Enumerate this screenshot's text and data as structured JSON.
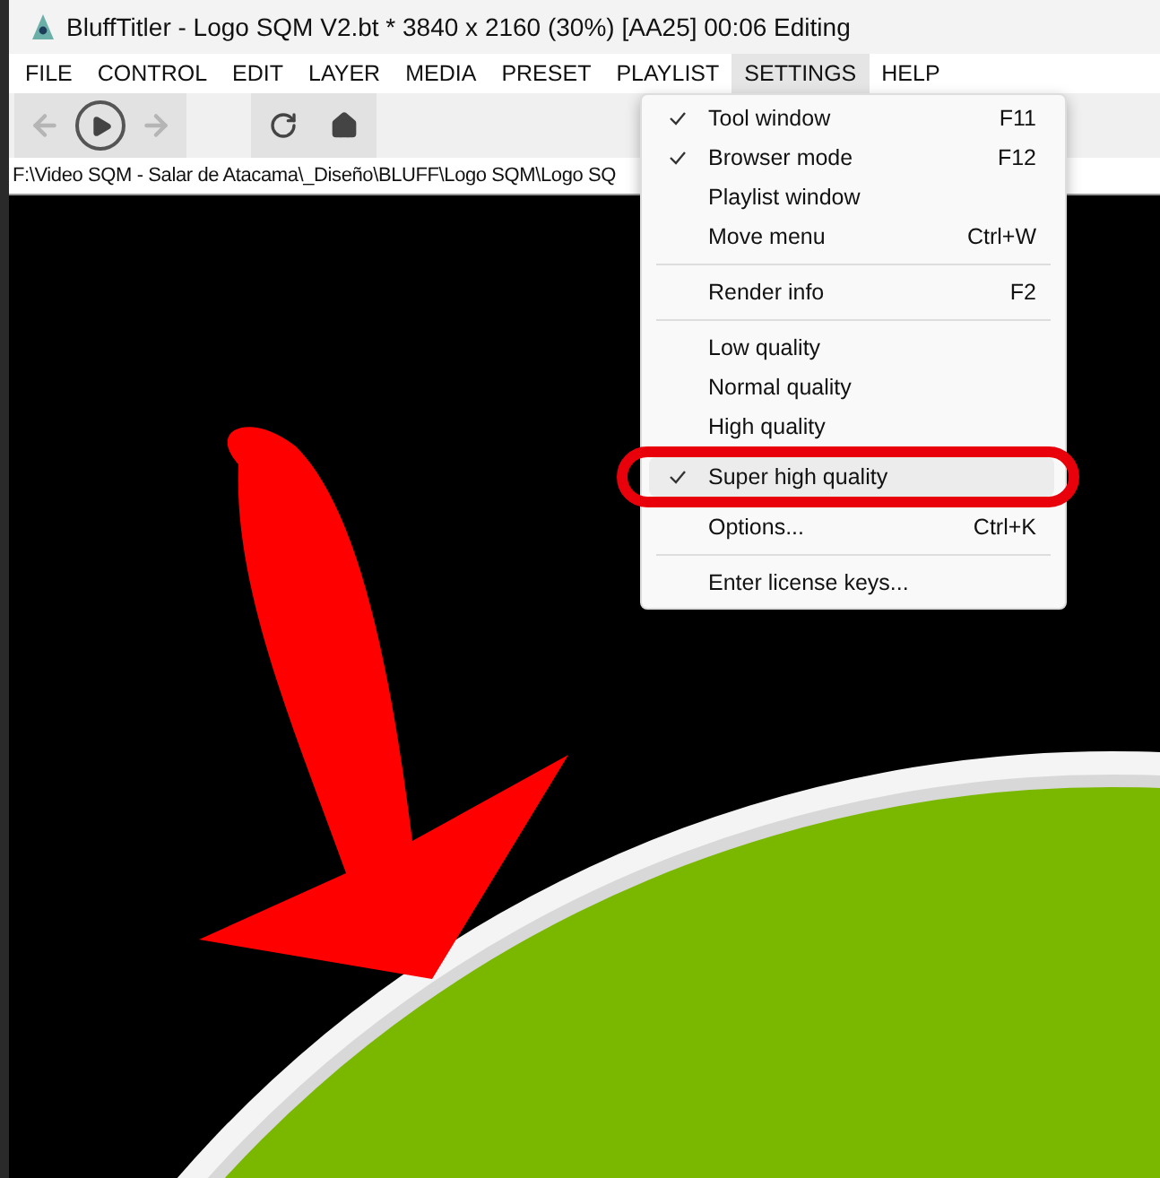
{
  "window": {
    "title": "BluffTitler - Logo SQM V2.bt * 3840 x 2160 (30%) [AA25] 00:06 Editing"
  },
  "menu_bar": [
    {
      "label": "FILE",
      "selected": false
    },
    {
      "label": "CONTROL",
      "selected": false
    },
    {
      "label": "EDIT",
      "selected": false
    },
    {
      "label": "LAYER",
      "selected": false
    },
    {
      "label": "MEDIA",
      "selected": false
    },
    {
      "label": "PRESET",
      "selected": false
    },
    {
      "label": "PLAYLIST",
      "selected": false
    },
    {
      "label": "SETTINGS",
      "selected": true
    },
    {
      "label": "HELP",
      "selected": false
    }
  ],
  "path_bar": {
    "text": "F:\\Video SQM - Salar de Atacama\\_Diseño\\BLUFF\\Logo SQM\\Logo SQ"
  },
  "dropdown": [
    {
      "kind": "item",
      "label": "Tool window",
      "shortcut": "F11",
      "checked": true,
      "selected": false,
      "circled": false
    },
    {
      "kind": "item",
      "label": "Browser mode",
      "shortcut": "F12",
      "checked": true,
      "selected": false,
      "circled": false
    },
    {
      "kind": "item",
      "label": "Playlist window",
      "checked": false,
      "selected": false,
      "circled": false
    },
    {
      "kind": "item",
      "label": "Move menu",
      "shortcut": "Ctrl+W",
      "checked": false,
      "selected": false,
      "circled": false
    },
    {
      "kind": "separator"
    },
    {
      "kind": "item",
      "label": "Render info",
      "shortcut": "F2",
      "checked": false,
      "selected": false,
      "circled": false
    },
    {
      "kind": "separator"
    },
    {
      "kind": "item",
      "label": "Low quality",
      "checked": false,
      "selected": false,
      "circled": false
    },
    {
      "kind": "item",
      "label": "Normal quality",
      "checked": false,
      "selected": false,
      "circled": false
    },
    {
      "kind": "item",
      "label": "High quality",
      "checked": false,
      "selected": false,
      "circled": false
    },
    {
      "kind": "item",
      "label": "Super high quality",
      "checked": true,
      "selected": true,
      "circled": true
    },
    {
      "kind": "item",
      "label": "Options...",
      "shortcut": "Ctrl+K",
      "checked": false,
      "selected": false,
      "circled": false
    },
    {
      "kind": "separator"
    },
    {
      "kind": "item",
      "label": "Enter license keys...",
      "checked": false,
      "selected": false,
      "circled": false
    }
  ]
}
